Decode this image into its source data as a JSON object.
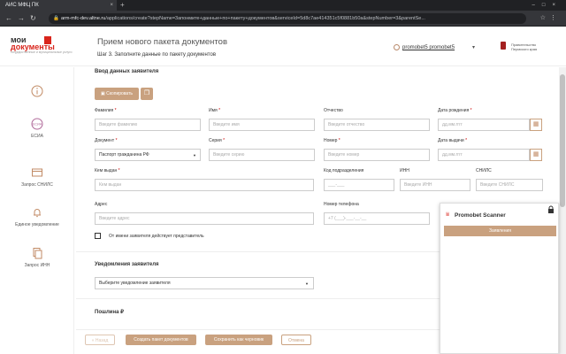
{
  "browser": {
    "tab_title": "АИС МФЦ ПК",
    "tab_close": "×",
    "new_tab": "+",
    "url_host": "arm-mfc-dev.altne.ru",
    "url_path": "/applications/create?stepName=3апонмите+данные+по+пакету+документов&serviceId=5d8c7ae414351c5f0881b50a&stepNumber=3&parentSe..."
  },
  "header": {
    "logo_line1a": "мои",
    "logo_line1b": "документы",
    "logo_line2": "государственные и муниципальные услуги",
    "title": "Прием нового пакета документов",
    "subtitle": "Шаг 3. Заполните данные по пакету документов",
    "user": "promobet5 promobet5",
    "gov_line1": "Правительство",
    "gov_line2": "Пермского края"
  },
  "sidebar": {
    "items": [
      {
        "label": ""
      },
      {
        "label": "ЕСИА"
      },
      {
        "label": "Запрос СНИЛС"
      },
      {
        "label": "Единое уведомление"
      },
      {
        "label": "Запрос ИНН"
      }
    ]
  },
  "form": {
    "section_applicant": "Ввод данных заявителя",
    "copy_button": "Скопировать",
    "fields": {
      "surname": {
        "label": "Фамилия",
        "placeholder": "Введите фамилию"
      },
      "name": {
        "label": "Имя",
        "placeholder": "Введите имя"
      },
      "patronymic": {
        "label": "Отчество",
        "placeholder": "Введите отчество"
      },
      "birthdate": {
        "label": "Дата рождения",
        "placeholder": "дд.мм.гггг"
      },
      "document": {
        "label": "Документ",
        "value": "Паспорт гражданина РФ"
      },
      "series": {
        "label": "Серия",
        "placeholder": "Введите серию"
      },
      "number": {
        "label": "Номер",
        "placeholder": "Введите номер"
      },
      "issue_date": {
        "label": "Дата выдачи",
        "placeholder": "дд.мм.гггг"
      },
      "issued_by": {
        "label": "Кем выдан",
        "placeholder": "Кем выдан"
      },
      "division_code": {
        "label": "Код подразделения",
        "placeholder": "___-___"
      },
      "inn": {
        "label": "ИНН",
        "placeholder": "Введите ИНН"
      },
      "snils": {
        "label": "СНИЛС",
        "placeholder": "Введите СНИЛС"
      },
      "address": {
        "label": "Адрес",
        "placeholder": "Введите адрес"
      },
      "phone": {
        "label": "Номер телефона",
        "placeholder": "+7 (___)-___-__-__"
      }
    },
    "representative_checkbox": "От имени заявителя действует представитель",
    "section_notifications": "Уведомления заявителя",
    "notification_select": "Выберите уведомление заявителя",
    "section_fee": "Пошлина ₽"
  },
  "footer": {
    "back": "« Назад",
    "create": "Создать пакет документов",
    "save_draft": "Сохранить как черновик",
    "cancel": "Отмена"
  },
  "popup": {
    "title": "Promobet Scanner",
    "bar": "Заявления"
  },
  "colors": {
    "accent": "#c9a17f",
    "brand_red": "#d9251c"
  }
}
